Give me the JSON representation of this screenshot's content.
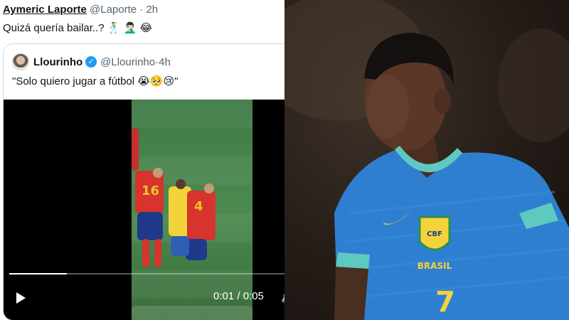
{
  "tweet": {
    "author_name": "Aymeric Laporte",
    "author_handle": "@Laporte",
    "separator": "·",
    "time": "2h",
    "text": "Quizá quería bailar..? 🕺 🤦🏻‍♂️ 😂"
  },
  "quote": {
    "author_name": "Llourinho",
    "verified_icon": "verified-badge-icon",
    "author_handle": "@Llourinho",
    "separator": "·",
    "time": "4h",
    "text": "\"Solo quiero jugar a fútbol 😭🥺😢\""
  },
  "video": {
    "time_display": "0:01 / 0:05",
    "progress": 0.2,
    "play_icon": "play-icon",
    "volume_icon": "volume-icon"
  },
  "photo": {
    "jersey_text": "BRASIL",
    "jersey_number": "7",
    "badge_text": "CBF"
  },
  "colors": {
    "link_gray": "#536471",
    "verified_blue": "#1d9bf0",
    "jersey_blue": "#2f7fd1",
    "jersey_yellow": "#f2d33b"
  }
}
